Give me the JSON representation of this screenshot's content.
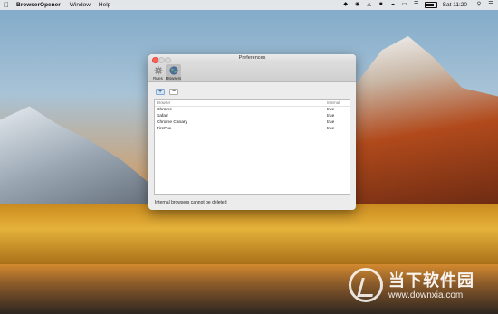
{
  "menubar": {
    "app_name": "BrowserOpener",
    "menus": [
      "Window",
      "Help"
    ],
    "clock": "Sat 11:20"
  },
  "window": {
    "title": "Preferences",
    "toolbar": [
      {
        "label": "Rules",
        "icon": "gear-icon"
      },
      {
        "label": "Browsers",
        "icon": "globe-icon",
        "active": true
      }
    ],
    "buttons": {
      "add": "+",
      "remove": "−"
    },
    "table": {
      "columns": [
        "Browser",
        "Internal"
      ],
      "rows": [
        {
          "browser": "Chrome",
          "internal": "true"
        },
        {
          "browser": "Safari",
          "internal": "true"
        },
        {
          "browser": "Chrome Canary",
          "internal": "true"
        },
        {
          "browser": "FireFox",
          "internal": "true"
        }
      ]
    },
    "note": "Internal browsers cannot be deleted"
  },
  "watermark": {
    "title": "当下软件园",
    "url": "www.downxia.com"
  }
}
